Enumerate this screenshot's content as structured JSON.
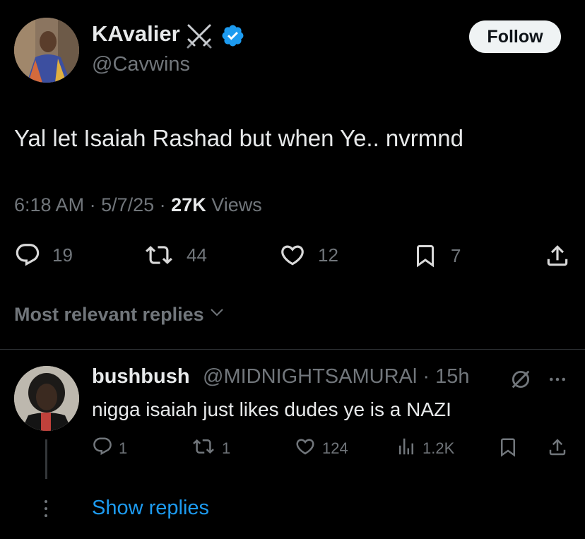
{
  "tweet": {
    "display_name": "KAvalier",
    "handle": "@Cavwins",
    "follow_label": "Follow",
    "text": "Yal let Isaiah Rashad but when Ye.. nvrmnd",
    "time": "6:18 AM",
    "date": "5/7/25",
    "views_count": "27K",
    "views_label": "Views",
    "replies": "19",
    "reposts": "44",
    "likes": "12",
    "bookmarks": "7"
  },
  "replies_section": {
    "sort_label": "Most relevant replies"
  },
  "reply": {
    "display_name": "bushbush",
    "handle_time": "@MIDNIGHTSAMURAl · 15h",
    "text": "nigga isaiah just likes dudes ye is a NAZI",
    "replies": "1",
    "reposts": "1",
    "likes": "124",
    "views": "1.2K",
    "show_replies_label": "Show replies"
  },
  "colors": {
    "background": "#000000",
    "text": "#e7e9ea",
    "muted": "#71767b",
    "accent": "#1d9bf0"
  }
}
